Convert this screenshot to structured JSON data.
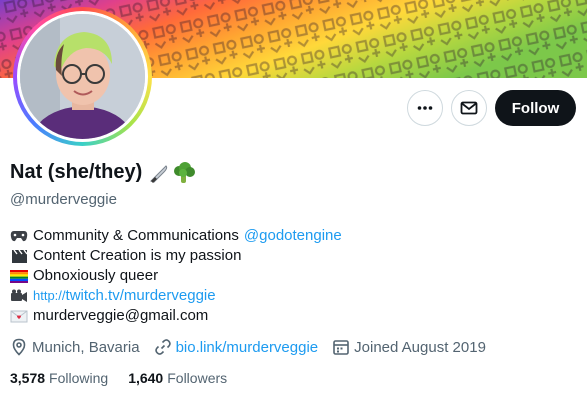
{
  "profile": {
    "display_name": "Nat (she/they)",
    "name_emojis": [
      "knife-emoji",
      "broccoli-emoji"
    ],
    "handle": "@murderveggie"
  },
  "actions": {
    "more_icon": "ellipsis-icon",
    "message_icon": "mail-icon",
    "follow_label": "Follow"
  },
  "bio": [
    {
      "icon": "game-controller-emoji",
      "text": "Community & Communications ",
      "mention": "@godotengine"
    },
    {
      "icon": "clapper-board-emoji",
      "text": "Content Creation is my passion"
    },
    {
      "icon": "rainbow-flag-emoji",
      "text": "Obnoxiously queer"
    },
    {
      "icon": "video-camera-emoji",
      "prefix": "http://",
      "link": "twitch.tv/murderveggie"
    },
    {
      "icon": "love-letter-emoji",
      "text": "murderveggie@gmail.com"
    }
  ],
  "meta": {
    "location": "Munich, Bavaria",
    "website": "bio.link/murderveggie",
    "joined": "Joined August 2019"
  },
  "stats": {
    "following_count": "3,578",
    "following_label": "Following",
    "followers_count": "1,640",
    "followers_label": "Followers"
  },
  "colors": {
    "accent": "#1d9bf0",
    "text": "#0f1419",
    "secondary": "#536471",
    "follow_bg": "#0f1419"
  }
}
